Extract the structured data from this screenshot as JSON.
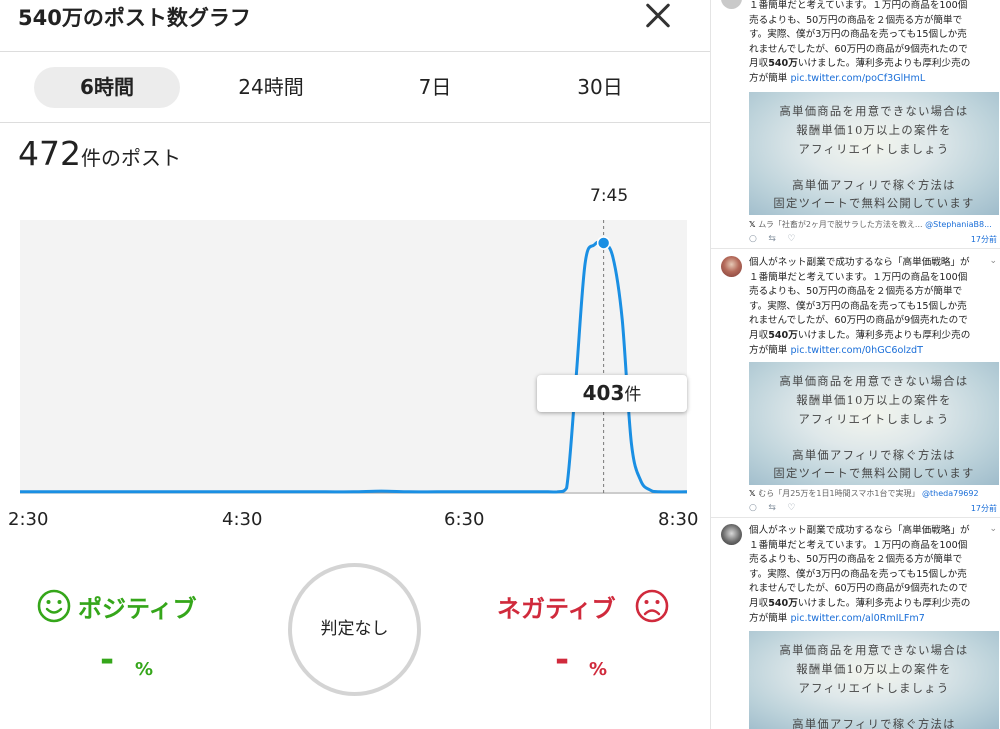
{
  "modal": {
    "title": "540万のポスト数グラフ",
    "tabs": [
      {
        "label": "6時間",
        "active": true
      },
      {
        "label": "24時間",
        "active": false
      },
      {
        "label": "7日",
        "active": false
      },
      {
        "label": "30日",
        "active": false
      }
    ],
    "count": {
      "value": "472",
      "unit": "件のポスト"
    },
    "tooltip": {
      "time": "7:45",
      "value": "403",
      "unit": "件"
    },
    "sentiment": {
      "positive": {
        "label": "ポジティブ",
        "value": "-",
        "unit": "%",
        "icon": "smile-icon",
        "color": "#35a61a"
      },
      "neutral": {
        "label": "判定なし"
      },
      "negative": {
        "label": "ネガティブ",
        "value": "-",
        "unit": "%",
        "icon": "frown-icon",
        "color": "#d02a3c"
      }
    }
  },
  "chart_data": {
    "type": "line",
    "x_tick_labels": [
      "2:30",
      "4:30",
      "6:30",
      "8:30"
    ],
    "xlim": [
      "2:30",
      "8:30"
    ],
    "ylim": [
      0,
      440
    ],
    "series": [
      {
        "color": "#1a8fe3",
        "x": [
          "2:30",
          "2:45",
          "3:00",
          "3:15",
          "3:30",
          "3:45",
          "4:00",
          "4:15",
          "4:30",
          "4:45",
          "5:00",
          "5:15",
          "5:30",
          "5:45",
          "6:00",
          "6:15",
          "6:30",
          "6:45",
          "7:00",
          "7:15",
          "7:20",
          "7:25",
          "7:30",
          "7:35",
          "7:40",
          "7:45",
          "7:50",
          "7:55",
          "8:00",
          "8:05",
          "8:10",
          "8:15",
          "8:30"
        ],
        "y": [
          2,
          2,
          2,
          2,
          2,
          2,
          2,
          2,
          2,
          2,
          2,
          2,
          2,
          3,
          2,
          2,
          2,
          2,
          2,
          2,
          2,
          8,
          180,
          370,
          400,
          403,
          380,
          280,
          80,
          20,
          5,
          2,
          2
        ]
      }
    ],
    "highlight": {
      "x": "7:45",
      "y": 403
    }
  },
  "feed": {
    "tweets": [
      {
        "text_lines": [
          "１番簡単だと考えています。１万円の商品を100個",
          "売るよりも、50万円の商品を２個売る方が簡単で",
          "す。実際、僕が3万円の商品を売っても15個しか売",
          "れませんでしたが、60万円の商品が9個売れたので"
        ],
        "last_line_pre": "月収",
        "last_line_bold": "540万",
        "last_line_post": "いけました。薄利多売よりも厚利少売の",
        "link_prefix": "方が簡単 ",
        "link": "pic.twitter.com/poCf3GlHmL",
        "image_lines": [
          "高単価商品を用意できない場合は",
          "報酬単価10万以上の案件を",
          "アフィリエイトしましょう",
          "高単価アフィリで稼ぐ方法は",
          "固定ツイートで無料公開しています"
        ],
        "quote": "ムラ「社畜が2ヶ月で脱サラした方法を教え...",
        "handle": "@StephaniaB8...",
        "time": "17分前"
      },
      {
        "text_lines": [
          "個人がネット副業で成功するなら「高単価戦略」が",
          "１番簡単だと考えています。１万円の商品を100個",
          "売るよりも、50万円の商品を２個売る方が簡単で",
          "す。実際、僕が3万円の商品を売っても15個しか売",
          "れませんでしたが、60万円の商品が9個売れたので"
        ],
        "last_line_pre": "月収",
        "last_line_bold": "540万",
        "last_line_post": "いけました。薄利多売よりも厚利少売の",
        "link_prefix": "方が簡単 ",
        "link": "pic.twitter.com/0hGC6olzdT",
        "image_lines": [
          "高単価商品を用意できない場合は",
          "報酬単価10万以上の案件を",
          "アフィリエイトしましょう",
          "高単価アフィリで稼ぐ方法は",
          "固定ツイートで無料公開しています"
        ],
        "quote": "むら「月25万を1日1時間スマホ1台で実現」",
        "handle": "@theda79692",
        "time": "17分前"
      },
      {
        "text_lines": [
          "個人がネット副業で成功するなら「高単価戦略」が",
          "１番簡単だと考えています。１万円の商品を100個",
          "売るよりも、50万円の商品を２個売る方が簡単で",
          "す。実際、僕が3万円の商品を売っても15個しか売",
          "れませんでしたが、60万円の商品が9個売れたので"
        ],
        "last_line_pre": "月収",
        "last_line_bold": "540万",
        "last_line_post": "いけました。薄利多売よりも厚利少売の",
        "link_prefix": "方が簡単 ",
        "link": "pic.twitter.com/al0RmILFm7",
        "image_lines": [
          "高単価商品を用意できない場合は",
          "報酬単価10万以上の案件を",
          "アフィリエイトしましょう",
          "高単価アフィリで稼ぐ方法は"
        ]
      }
    ]
  }
}
